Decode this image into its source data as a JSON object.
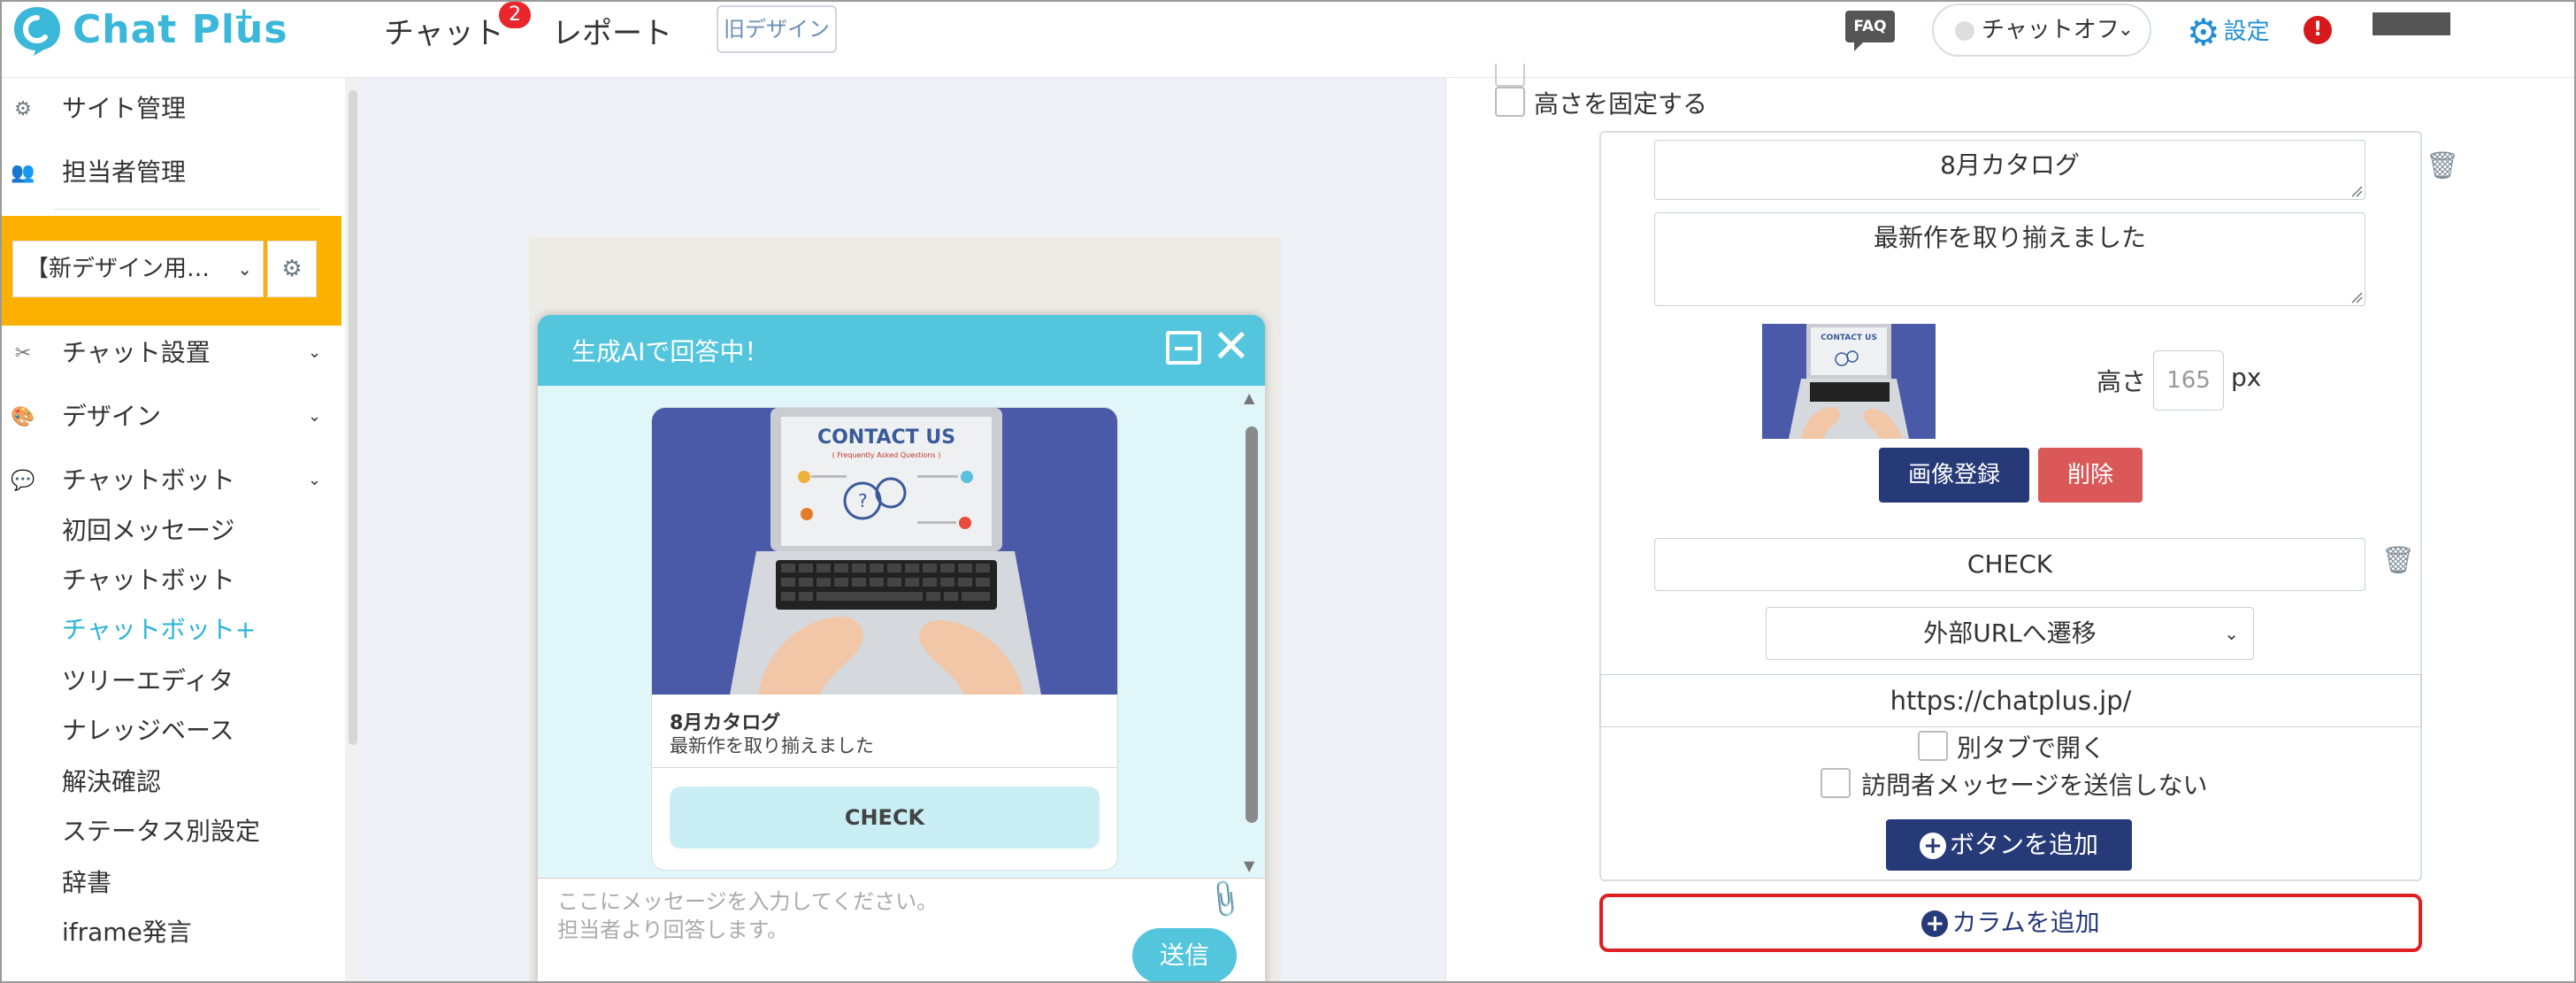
{
  "header": {
    "logo_text": "Chat Plus",
    "logo_plus": "+",
    "nav_chat": "チャット",
    "nav_chat_badge": "2",
    "nav_report": "レポート",
    "old_design": "旧デザイン",
    "faq": "FAQ",
    "chat_status": "チャットオフ",
    "settings": "設定",
    "alert": "!"
  },
  "sidebar": {
    "site_manage": "サイト管理",
    "agent_manage": "担当者管理",
    "site_select": "【新デザイン用…",
    "chat_settings": "チャット設置",
    "design": "デザイン",
    "chatbot": "チャットボット",
    "sub_items": [
      "初回メッセージ",
      "チャットボット",
      "チャットボット+",
      "ツリーエディタ",
      "ナレッジベース",
      "解決確認",
      "ステータス別設定",
      "辞書",
      "iframe発言"
    ],
    "active_item": "チャットボット+"
  },
  "widget": {
    "title": "生成AIで回答中！",
    "image_text": "CONTACT US",
    "image_subtext": "( Frequently Asked Questions )",
    "card_title": "8月カタログ",
    "card_desc": "最新作を取り揃えました",
    "card_button": "CHECK",
    "input_placeholder_1": "ここにメッセージを入力してください。",
    "input_placeholder_2": "担当者より回答します。",
    "send": "送信"
  },
  "panel": {
    "fix_height": "高さを固定する",
    "title_value": "8月カタログ",
    "desc_value": "最新作を取り揃えました",
    "height_label": "高さ",
    "height_value": "165",
    "height_unit": "px",
    "image_register": "画像登録",
    "image_delete": "削除",
    "button_label_value": "CHECK",
    "action_select": "外部URLへ遷移",
    "url_value": "https://chatplus.jp/",
    "open_new_tab": "別タブで開く",
    "no_visitor_message": "訪問者メッセージを送信しない",
    "add_button": "ボタンを追加",
    "add_column": "カラムを追加"
  },
  "colors": {
    "brand": "#3ab7d9",
    "sidebar_highlight": "#fcb100",
    "primary_button": "#273a78",
    "danger_button": "#db5858",
    "widget_header": "#53c5dd",
    "highlight_border": "#e02020"
  }
}
